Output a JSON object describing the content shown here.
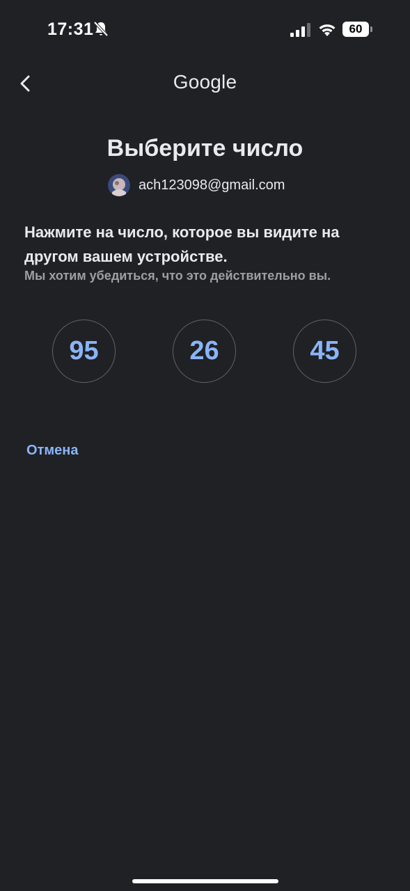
{
  "status_bar": {
    "time": "17:31",
    "battery_level": "60",
    "icons": [
      "bell-muted-icon",
      "cellular-signal-icon",
      "wifi-icon",
      "battery-icon"
    ]
  },
  "header": {
    "back_icon": "chevron-left-icon",
    "brand": "Google"
  },
  "main": {
    "title": "Выберите число",
    "account_email": "ach123098@gmail.com",
    "instruction": "Нажмите на число, которое вы видите на другом вашем устройстве.",
    "sub_instruction": "Мы хотим убедиться, что это действительно вы.",
    "numbers": [
      "95",
      "26",
      "45"
    ],
    "cancel_label": "Отмена"
  },
  "colors": {
    "background": "#202124",
    "text_primary": "#e8eaed",
    "text_secondary": "#9aa0a6",
    "accent": "#8ab4f8",
    "circle_border": "#5f6368"
  }
}
